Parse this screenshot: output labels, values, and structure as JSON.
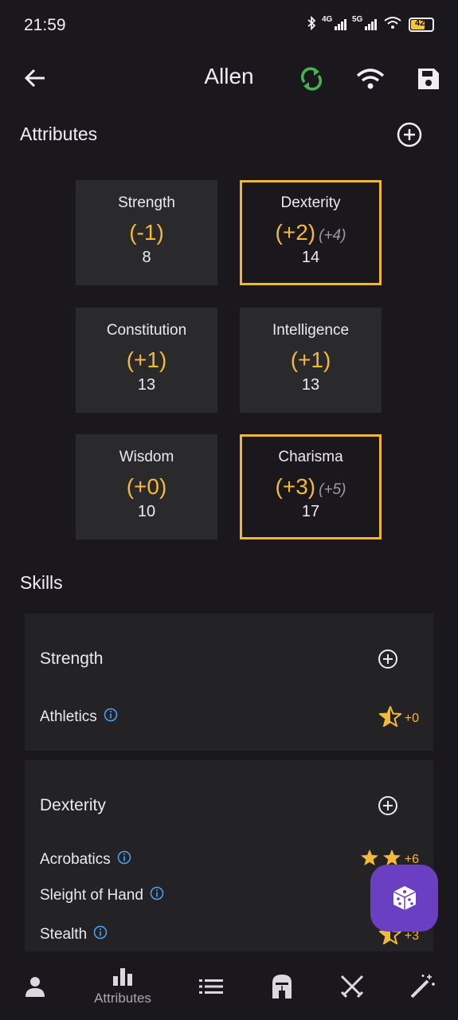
{
  "status_bar": {
    "time": "21:59",
    "net1": "4G",
    "net2": "5G",
    "battery": "42"
  },
  "app_bar": {
    "title": "Allen"
  },
  "attributes": {
    "title": "Attributes",
    "cards": [
      {
        "name": "Strength",
        "modifier": "(-1)",
        "extra": "",
        "value": "8",
        "highlighted": false
      },
      {
        "name": "Dexterity",
        "modifier": "(+2)",
        "extra": "(+4)",
        "value": "14",
        "highlighted": true
      },
      {
        "name": "Constitution",
        "modifier": "(+1)",
        "extra": "",
        "value": "13",
        "highlighted": false
      },
      {
        "name": "Intelligence",
        "modifier": "(+1)",
        "extra": "",
        "value": "13",
        "highlighted": false
      },
      {
        "name": "Wisdom",
        "modifier": "(+0)",
        "extra": "",
        "value": "10",
        "highlighted": false
      },
      {
        "name": "Charisma",
        "modifier": "(+3)",
        "extra": "(+5)",
        "value": "17",
        "highlighted": true
      }
    ]
  },
  "skills": {
    "title": "Skills",
    "groups": [
      {
        "name": "Strength",
        "skills": [
          {
            "name": "Athletics",
            "bonus": "+0",
            "stars": "half"
          }
        ]
      },
      {
        "name": "Dexterity",
        "skills": [
          {
            "name": "Acrobatics",
            "bonus": "+6",
            "stars": "two"
          },
          {
            "name": "Sleight of Hand",
            "bonus": "",
            "stars": "none"
          },
          {
            "name": "Stealth",
            "bonus": "+3",
            "stars": "half"
          }
        ]
      }
    ]
  },
  "bottom_nav": {
    "active_label": "Attributes"
  },
  "colors": {
    "accent": "#f5b933",
    "fab": "#6b3fc2",
    "sync": "#3fb950",
    "info": "#4aa3ff"
  }
}
